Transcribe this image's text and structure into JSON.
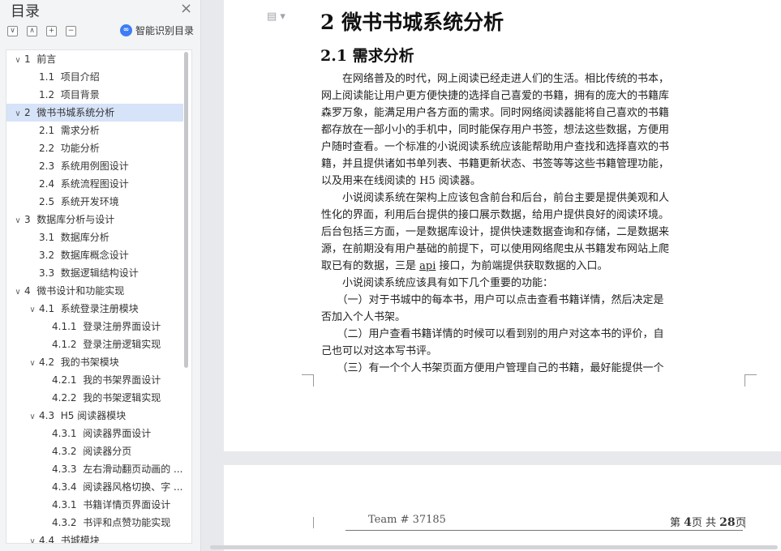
{
  "sidebar": {
    "title": "目录",
    "close_icon": "×",
    "tools": [
      {
        "name": "collapse-all-button",
        "symbol": "∨"
      },
      {
        "name": "expand-up-button",
        "symbol": "∧"
      },
      {
        "name": "add-heading-button",
        "symbol": "+"
      },
      {
        "name": "remove-heading-button",
        "symbol": "−"
      }
    ],
    "smart_label": "智能识别目录",
    "smart_icon": "∞",
    "items": [
      {
        "num": "1",
        "label": "前言",
        "level": 1,
        "toggle": "∨",
        "selected": false
      },
      {
        "num": "1.1",
        "label": "项目介绍",
        "level": 2,
        "toggle": "",
        "selected": false
      },
      {
        "num": "1.2",
        "label": "项目背景",
        "level": 2,
        "toggle": "",
        "selected": false
      },
      {
        "num": "2",
        "label": "微书书城系统分析",
        "level": 1,
        "toggle": "∨",
        "selected": true
      },
      {
        "num": "2.1",
        "label": "需求分析",
        "level": 2,
        "toggle": "",
        "selected": false
      },
      {
        "num": "2.2",
        "label": "功能分析",
        "level": 2,
        "toggle": "",
        "selected": false
      },
      {
        "num": "2.3",
        "label": "系统用例图设计",
        "level": 2,
        "toggle": "",
        "selected": false
      },
      {
        "num": "2.4",
        "label": "系统流程图设计",
        "level": 2,
        "toggle": "",
        "selected": false
      },
      {
        "num": "2.5",
        "label": "系统开发环境",
        "level": 2,
        "toggle": "",
        "selected": false
      },
      {
        "num": "3",
        "label": "数据库分析与设计",
        "level": 1,
        "toggle": "∨",
        "selected": false
      },
      {
        "num": "3.1",
        "label": "数据库分析",
        "level": 2,
        "toggle": "",
        "selected": false
      },
      {
        "num": "3.2",
        "label": "数据库概念设计",
        "level": 2,
        "toggle": "",
        "selected": false
      },
      {
        "num": "3.3",
        "label": "数据逻辑结构设计",
        "level": 2,
        "toggle": "",
        "selected": false
      },
      {
        "num": "4",
        "label": "微书设计和功能实现",
        "level": 1,
        "toggle": "∨",
        "selected": false
      },
      {
        "num": "4.1",
        "label": "系统登录注册模块",
        "level": 2,
        "toggle": "∨",
        "selected": false
      },
      {
        "num": "4.1.1",
        "label": "登录注册界面设计",
        "level": 3,
        "toggle": "",
        "selected": false
      },
      {
        "num": "4.1.2",
        "label": "登录注册逻辑实现",
        "level": 3,
        "toggle": "",
        "selected": false
      },
      {
        "num": "4.2",
        "label": "我的书架模块",
        "level": 2,
        "toggle": "∨",
        "selected": false
      },
      {
        "num": "4.2.1",
        "label": "我的书架界面设计",
        "level": 3,
        "toggle": "",
        "selected": false
      },
      {
        "num": "4.2.2",
        "label": "我的书架逻辑实现",
        "level": 3,
        "toggle": "",
        "selected": false
      },
      {
        "num": "4.3",
        "label": "H5 阅读器模块",
        "level": 2,
        "toggle": "∨",
        "selected": false
      },
      {
        "num": "4.3.1",
        "label": "阅读器界面设计",
        "level": 3,
        "toggle": "",
        "selected": false
      },
      {
        "num": "4.3.2",
        "label": "阅读器分页",
        "level": 3,
        "toggle": "",
        "selected": false
      },
      {
        "num": "4.3.3",
        "label": "左右滑动翻页动画的 ...",
        "level": 3,
        "toggle": "",
        "selected": false
      },
      {
        "num": "4.3.4",
        "label": "阅读器风格切换、字 ...",
        "level": 3,
        "toggle": "",
        "selected": false
      },
      {
        "num": "4.3.1",
        "label": "书籍详情页界面设计",
        "level": 3,
        "toggle": "",
        "selected": false
      },
      {
        "num": "4.3.2",
        "label": "书评和点赞功能实现",
        "level": 3,
        "toggle": "",
        "selected": false
      },
      {
        "num": "4.4",
        "label": "书城模块",
        "level": 2,
        "toggle": "∨",
        "selected": false
      }
    ]
  },
  "document": {
    "heading1": "2  微书书城系统分析",
    "heading2": "2.1  需求分析",
    "lines": [
      "　　在网络普及的时代，网上阅读已经走进人们的生活。相比传统的书本，",
      "网上阅读能让用户更方便快捷的选择自己喜爱的书籍，拥有的庞大的书籍库",
      "森罗万象，能满足用户各方面的需求。同时网络阅读器能将自己喜欢的书籍",
      "都存放在一部小小的手机中，同时能保存用户书签，想法这些数据，方便用",
      "户随时查看。一个标准的小说阅读系统应该能帮助用户查找和选择喜欢的书",
      "籍，并且提供诸如书单列表、书籍更新状态、书签等等这些书籍管理功能，",
      "以及用来在线阅读的 H5 阅读器。",
      "　　小说阅读系统在架构上应该包含前台和后台，前台主要是提供美观和人",
      "性化的界面，利用后台提供的接口展示数据，给用户提供良好的阅读环境。",
      "后台包括三方面，一是数据库设计，提供快速数据查询和存储，二是数据来",
      "源，在前期没有用户基础的前提下，可以使用网络爬虫从书籍发布网站上爬",
      "取已有的数据，三是 api 接口，为前端提供获取数据的入口。",
      "　　小说阅读系统应该具有如下几个重要的功能：",
      "　　（一）对于书城中的每本书，用户可以点击查看书籍详情，然后决定是",
      "否加入个人书架。",
      "　　（二）用户查看书籍详情的时候可以看到别的用户对这本书的评价，自",
      "己也可以对这本写书评。",
      "　　（三）有一个个人书架页面方便用户管理自己的书籍，最好能提供一个"
    ],
    "footer_team": "Team # 37185",
    "footer_page_prefix": "第 ",
    "footer_page_num": "4",
    "footer_page_mid": "页 共 ",
    "footer_page_total": "28",
    "footer_page_suffix": "页"
  }
}
